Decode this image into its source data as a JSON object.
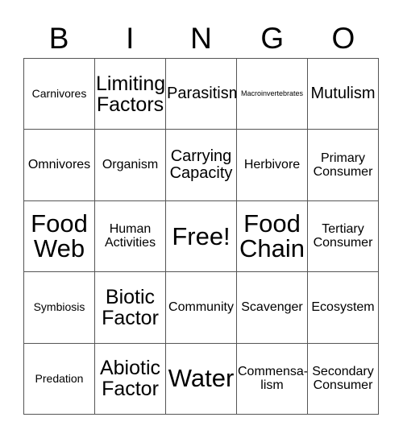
{
  "card": {
    "title_letters": [
      "B",
      "I",
      "N",
      "G",
      "O"
    ],
    "grid": {
      "rows": 5,
      "columns": 5,
      "border_color": "#555555",
      "background_color": "#ffffff",
      "text_color": "#000000"
    },
    "cells": [
      {
        "label": "Carnivores",
        "size": "sz-s"
      },
      {
        "label": "Limiting\nFactors",
        "size": "sz-xl"
      },
      {
        "label": "Parasitism",
        "size": "sz-l"
      },
      {
        "label": "Macroinvertebrates",
        "size": "sz-xs"
      },
      {
        "label": "Mutulism",
        "size": "sz-l"
      },
      {
        "label": "Omnivores",
        "size": "sz-m"
      },
      {
        "label": "Organism",
        "size": "sz-m"
      },
      {
        "label": "Carrying\nCapacity",
        "size": "sz-l"
      },
      {
        "label": "Herbivore",
        "size": "sz-m"
      },
      {
        "label": "Primary\nConsumer",
        "size": "sz-m"
      },
      {
        "label": "Food\nWeb",
        "size": "sz-xxl"
      },
      {
        "label": "Human\nActivities",
        "size": "sz-m"
      },
      {
        "label": "Free!",
        "size": "sz-xxl"
      },
      {
        "label": "Food\nChain",
        "size": "sz-xxl"
      },
      {
        "label": "Tertiary\nConsumer",
        "size": "sz-m"
      },
      {
        "label": "Symbiosis",
        "size": "sz-s"
      },
      {
        "label": "Biotic\nFactor",
        "size": "sz-xl"
      },
      {
        "label": "Community",
        "size": "sz-m"
      },
      {
        "label": "Scavenger",
        "size": "sz-m"
      },
      {
        "label": "Ecosystem",
        "size": "sz-m"
      },
      {
        "label": "Predation",
        "size": "sz-s"
      },
      {
        "label": "Abiotic\nFactor",
        "size": "sz-xl"
      },
      {
        "label": "Water",
        "size": "sz-xxl"
      },
      {
        "label": "Commensa-\nlism",
        "size": "sz-m"
      },
      {
        "label": "Secondary\nConsumer",
        "size": "sz-m"
      }
    ]
  }
}
